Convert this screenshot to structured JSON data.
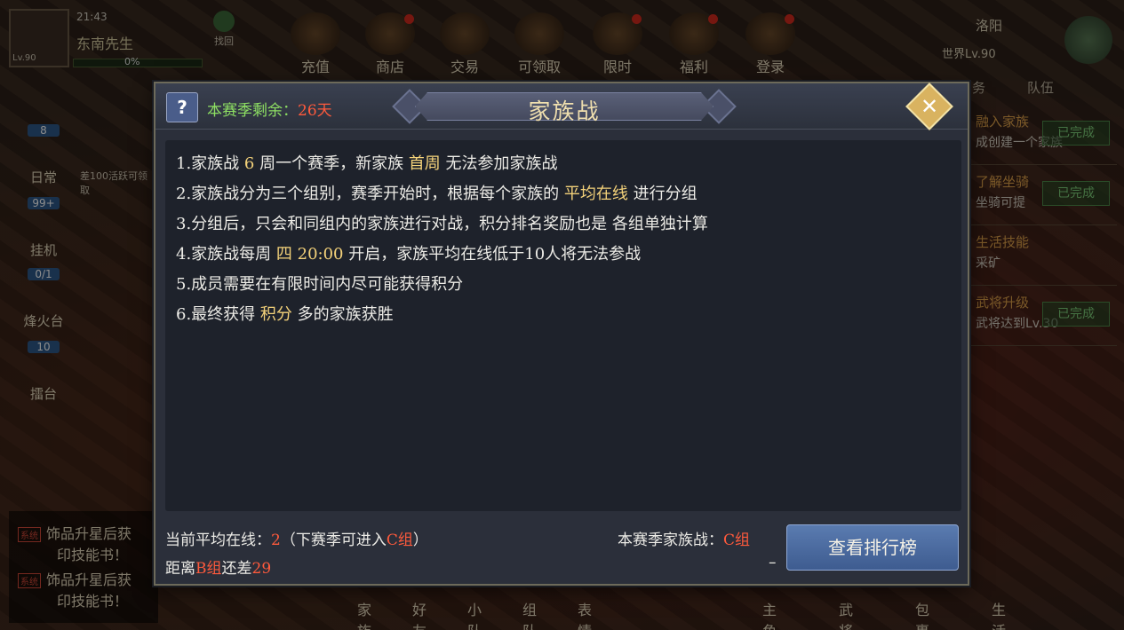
{
  "hud": {
    "clock": "21:43",
    "player_name": "东南先生",
    "level": "Lv.90",
    "exp_text": "0%",
    "exp_fraction": 0.0,
    "back_label": "找回",
    "nav": [
      {
        "label": "充值",
        "icon": "coin-icon",
        "dot": false
      },
      {
        "label": "商店",
        "icon": "shop-icon",
        "dot": true
      },
      {
        "label": "交易",
        "icon": "trade-icon",
        "dot": false
      },
      {
        "label": "可领取",
        "icon": "reward-icon",
        "dot": false
      },
      {
        "label": "限时",
        "icon": "hourglass-icon",
        "dot": true
      },
      {
        "label": "福利",
        "icon": "gift-icon",
        "dot": true
      },
      {
        "label": "登录",
        "icon": "login-icon",
        "dot": true
      }
    ],
    "city": "洛阳",
    "world_level": "世界Lv.90",
    "side": [
      {
        "count": "8",
        "label": "日常"
      },
      {
        "count": "99+",
        "label": "挂机"
      },
      {
        "count": "0/1",
        "label": "烽火台"
      },
      {
        "count": "10",
        "label": "擂台"
      }
    ],
    "side_extra": "差100活跃可领取",
    "quest_tabs": [
      "务",
      "队伍"
    ],
    "quests": [
      {
        "title": "融入家族",
        "desc": "成创建一个家族",
        "status": "已完成"
      },
      {
        "title": "了解坐骑",
        "desc": "坐骑可提",
        "status": "已完成"
      },
      {
        "title": "生活技能",
        "desc": "采矿",
        "status": ""
      },
      {
        "title": "武将升级",
        "desc": "武将达到Lv.30",
        "status": "已完成"
      }
    ],
    "chat": [
      {
        "tag": "系统",
        "text": "饰品升星后获"
      },
      {
        "tag": "",
        "text": "印技能书！"
      },
      {
        "tag": "系统",
        "text": "饰品升星后获"
      },
      {
        "tag": "",
        "text": "印技能书！"
      }
    ],
    "bottom_left": [
      "家族",
      "好友",
      "小队",
      "组队",
      "表情"
    ],
    "bottom_right": [
      "主角",
      "武将",
      "包裹",
      "生活"
    ]
  },
  "modal": {
    "help_label": "?",
    "season_label": "本赛季剩余：",
    "season_days": "26天",
    "title": "家族战",
    "close_label": "✕",
    "rules": [
      [
        {
          "t": "1.家族战 "
        },
        {
          "t": "6",
          "hl": true
        },
        {
          "t": " 周一个赛季，新家族 "
        },
        {
          "t": "首周",
          "hl": true
        },
        {
          "t": " 无法参加家族战"
        }
      ],
      [
        {
          "t": "2.家族战分为三个组别，赛季开始时，根据每个家族的 "
        },
        {
          "t": "平均在线",
          "hl": true
        },
        {
          "t": " 进行分组"
        }
      ],
      [
        {
          "t": "3.分组后，只会和同组内的家族进行对战，积分排名奖励也是 各组单独计算"
        }
      ],
      [
        {
          "t": "4.家族战每周 "
        },
        {
          "t": "四 20:00",
          "hl": true
        },
        {
          "t": " 开启，家族平均在线低于10人将无法参战"
        }
      ],
      [
        {
          "t": "5.成员需要在有限时间内尽可能获得积分"
        }
      ],
      [
        {
          "t": "6.最终获得 "
        },
        {
          "t": "积分",
          "hl": true
        },
        {
          "t": " 多的家族获胜"
        }
      ]
    ],
    "footer": {
      "avg_online_label": "当前平均在线：",
      "avg_online_value": "2",
      "next_season_prefix": "（下赛季可进入",
      "next_season_group": "C组",
      "next_season_suffix": "）",
      "distance_prefix": "距离",
      "distance_group": "B组",
      "distance_mid": "还差",
      "distance_value": "29",
      "current_label": "本赛季家族战：",
      "current_group": "C组",
      "dash": "–",
      "rank_button": "查看排行榜"
    }
  },
  "colors": {
    "highlight": "#f4d27a",
    "red": "#ff5a3c",
    "green": "#8ee063",
    "button_blue": "#4a6aa0"
  }
}
